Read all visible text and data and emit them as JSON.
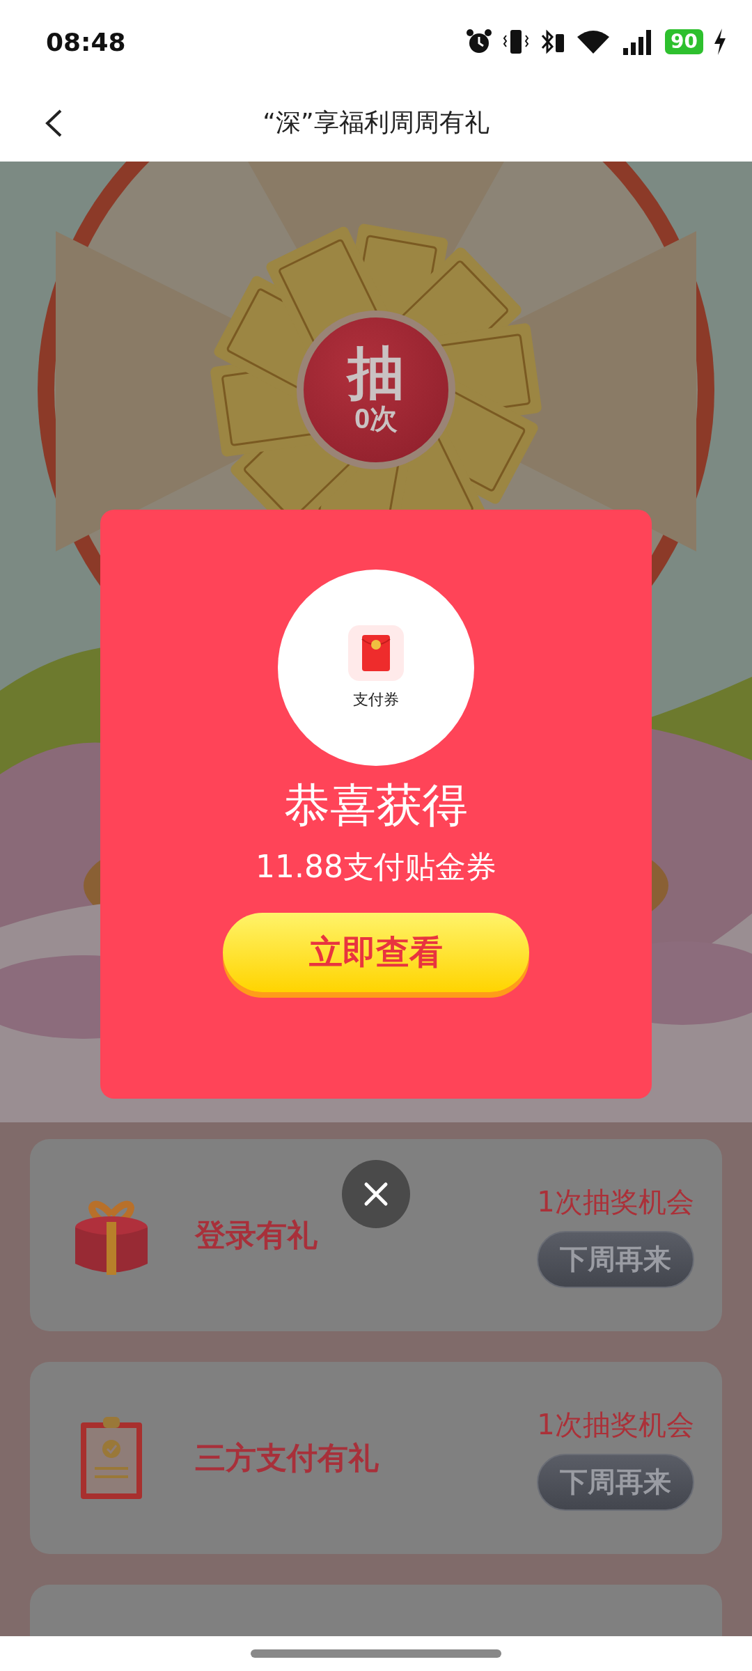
{
  "status_bar": {
    "time": "08:48",
    "battery": "90",
    "charging": true
  },
  "header": {
    "title": "“深”享福利周周有礼"
  },
  "draw_button": {
    "label": "抽",
    "count": "0次"
  },
  "tasks": [
    {
      "kind": "gift",
      "title": "登录有礼",
      "chance": "1次抽奖机会",
      "button": "下周再来"
    },
    {
      "kind": "clipboard",
      "title": "三方支付有礼",
      "chance": "1次抽奖机会",
      "button": "下周再来"
    },
    {
      "kind": "cut"
    }
  ],
  "dialog": {
    "prize_label": "支付券",
    "title": "恭喜获得",
    "prize": "11.88支付贴金券",
    "button": "立即查看"
  }
}
